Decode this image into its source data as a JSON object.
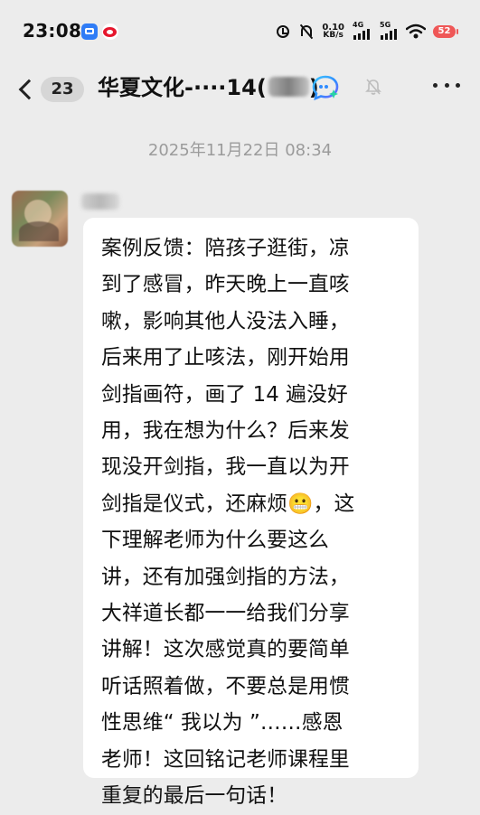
{
  "status_bar": {
    "time": "23:08",
    "speed_value": "0.10",
    "speed_unit": "KB/s",
    "signal_1": "4G",
    "signal_2": "5G",
    "battery": "52"
  },
  "header": {
    "unread_count": "23",
    "title": "华夏文化-····14(",
    "title_suffix": ")"
  },
  "chat": {
    "timestamp": "2025年11月22日 08:34",
    "message_lines": [
      "案例反馈：陪孩子逛街，凉",
      "到了感冒，昨天晚上一直咳",
      "嗽，影响其他人没法入睡，",
      "后来用了止咳法，刚开始用",
      "剑指画符，画了 14 遍没好",
      "用，我在想为什么？后来发",
      "现没开剑指，我一直以为开",
      "剑指是仪式，还麻烦😬，这",
      "下理解老师为什么要这么",
      "讲，还有加强剑指的方法，",
      "大祥道长都一一给我们分享",
      "讲解！这次感觉真的要简单",
      "听话照着做，不要总是用惯",
      "性思维“ 我以为 ”……感恩",
      "老师！这回铭记老师课程里",
      "重复的最后一句话！"
    ]
  },
  "colors": {
    "background": "#ececec",
    "bubble": "#ffffff",
    "timestamp": "#9b9b9b",
    "battery": "#ef5757"
  },
  "icons": [
    "back-icon",
    "ai-chat-icon",
    "bell-off-icon",
    "more-icon",
    "alarm-icon",
    "mute-icon",
    "wifi-icon"
  ]
}
